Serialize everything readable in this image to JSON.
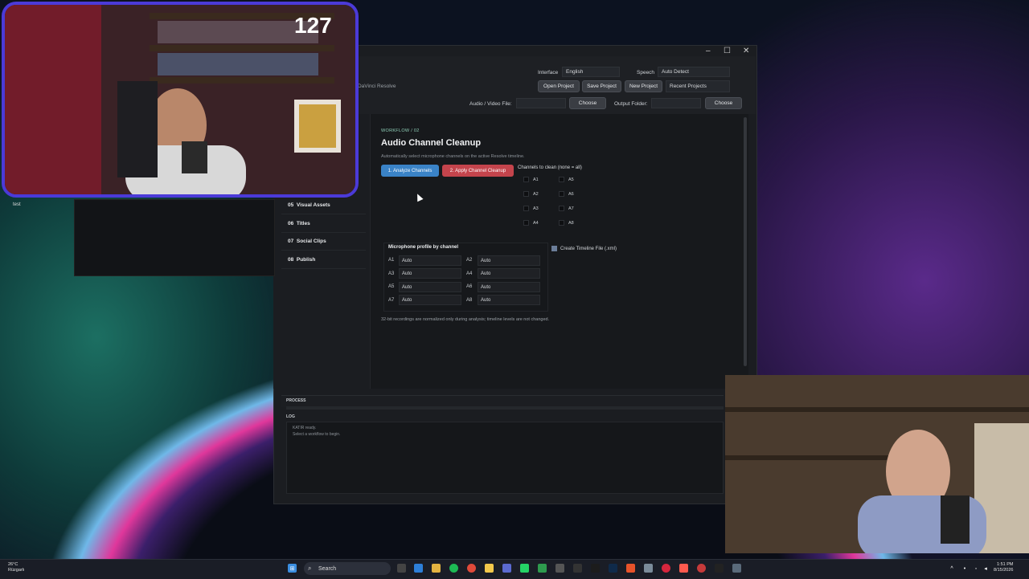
{
  "desktop": {
    "icon_label": "test"
  },
  "stream": {
    "viewer_count": "127"
  },
  "window": {
    "controls": {
      "minimize": "–",
      "maximize": "☐",
      "close": "✕"
    },
    "app_subtitle": "r DaVinci Resolve",
    "interface_label": "Interface",
    "interface_value": "English",
    "speech_label": "Speech",
    "speech_value": "Auto Detect",
    "buttons": {
      "open_project": "Open Project",
      "save_project": "Save Project",
      "new_project": "New Project",
      "recent_projects": "Recent Projects"
    },
    "audio_video_label": "Audio / Video File:",
    "audio_choose": "Choose",
    "output_folder_label": "Output Folder:",
    "output_choose": "Choose"
  },
  "sidebar": {
    "items": [
      {
        "num": "05",
        "label": "Visual Assets"
      },
      {
        "num": "06",
        "label": "Titles"
      },
      {
        "num": "07",
        "label": "Social Clips"
      },
      {
        "num": "08",
        "label": "Publish"
      }
    ]
  },
  "main": {
    "breadcrumb": "WORKFLOW  /  02",
    "title": "Audio Channel Cleanup",
    "subtitle": "Automatically select microphone channels on the active Resolve timeline.",
    "analyze_button": "1. Analyze Channels",
    "apply_button": "2. Apply Channel Cleanup",
    "channels_title": "Channels to clean (none = all)",
    "channels": [
      "A1",
      "A2",
      "A3",
      "A4",
      "A5",
      "A6",
      "A7",
      "A8"
    ],
    "mic_title": "Microphone profile by channel",
    "mic_rows": [
      {
        "ch1": "A1",
        "v1": "Auto",
        "ch2": "A2",
        "v2": "Auto"
      },
      {
        "ch1": "A3",
        "v1": "Auto",
        "ch2": "A4",
        "v2": "Auto"
      },
      {
        "ch1": "A5",
        "v1": "Auto",
        "ch2": "A6",
        "v2": "Auto"
      },
      {
        "ch1": "A7",
        "v1": "Auto",
        "ch2": "A8",
        "v2": "Auto"
      }
    ],
    "create_timeline_label": "Create Timeline File (.xml)",
    "note": "32-bit recordings are normalized only during analysis; timeline levels are not changed."
  },
  "process": {
    "label": "PROCESS"
  },
  "log": {
    "label": "LOG",
    "lines": [
      "KATIR ready.",
      "Select a workflow to begin."
    ]
  },
  "taskbar": {
    "weather_temp": "26°C",
    "weather_loc": "Rüzgarlı",
    "search_label": "Search",
    "time": "1:51 PM",
    "date": "8/15/2026"
  }
}
